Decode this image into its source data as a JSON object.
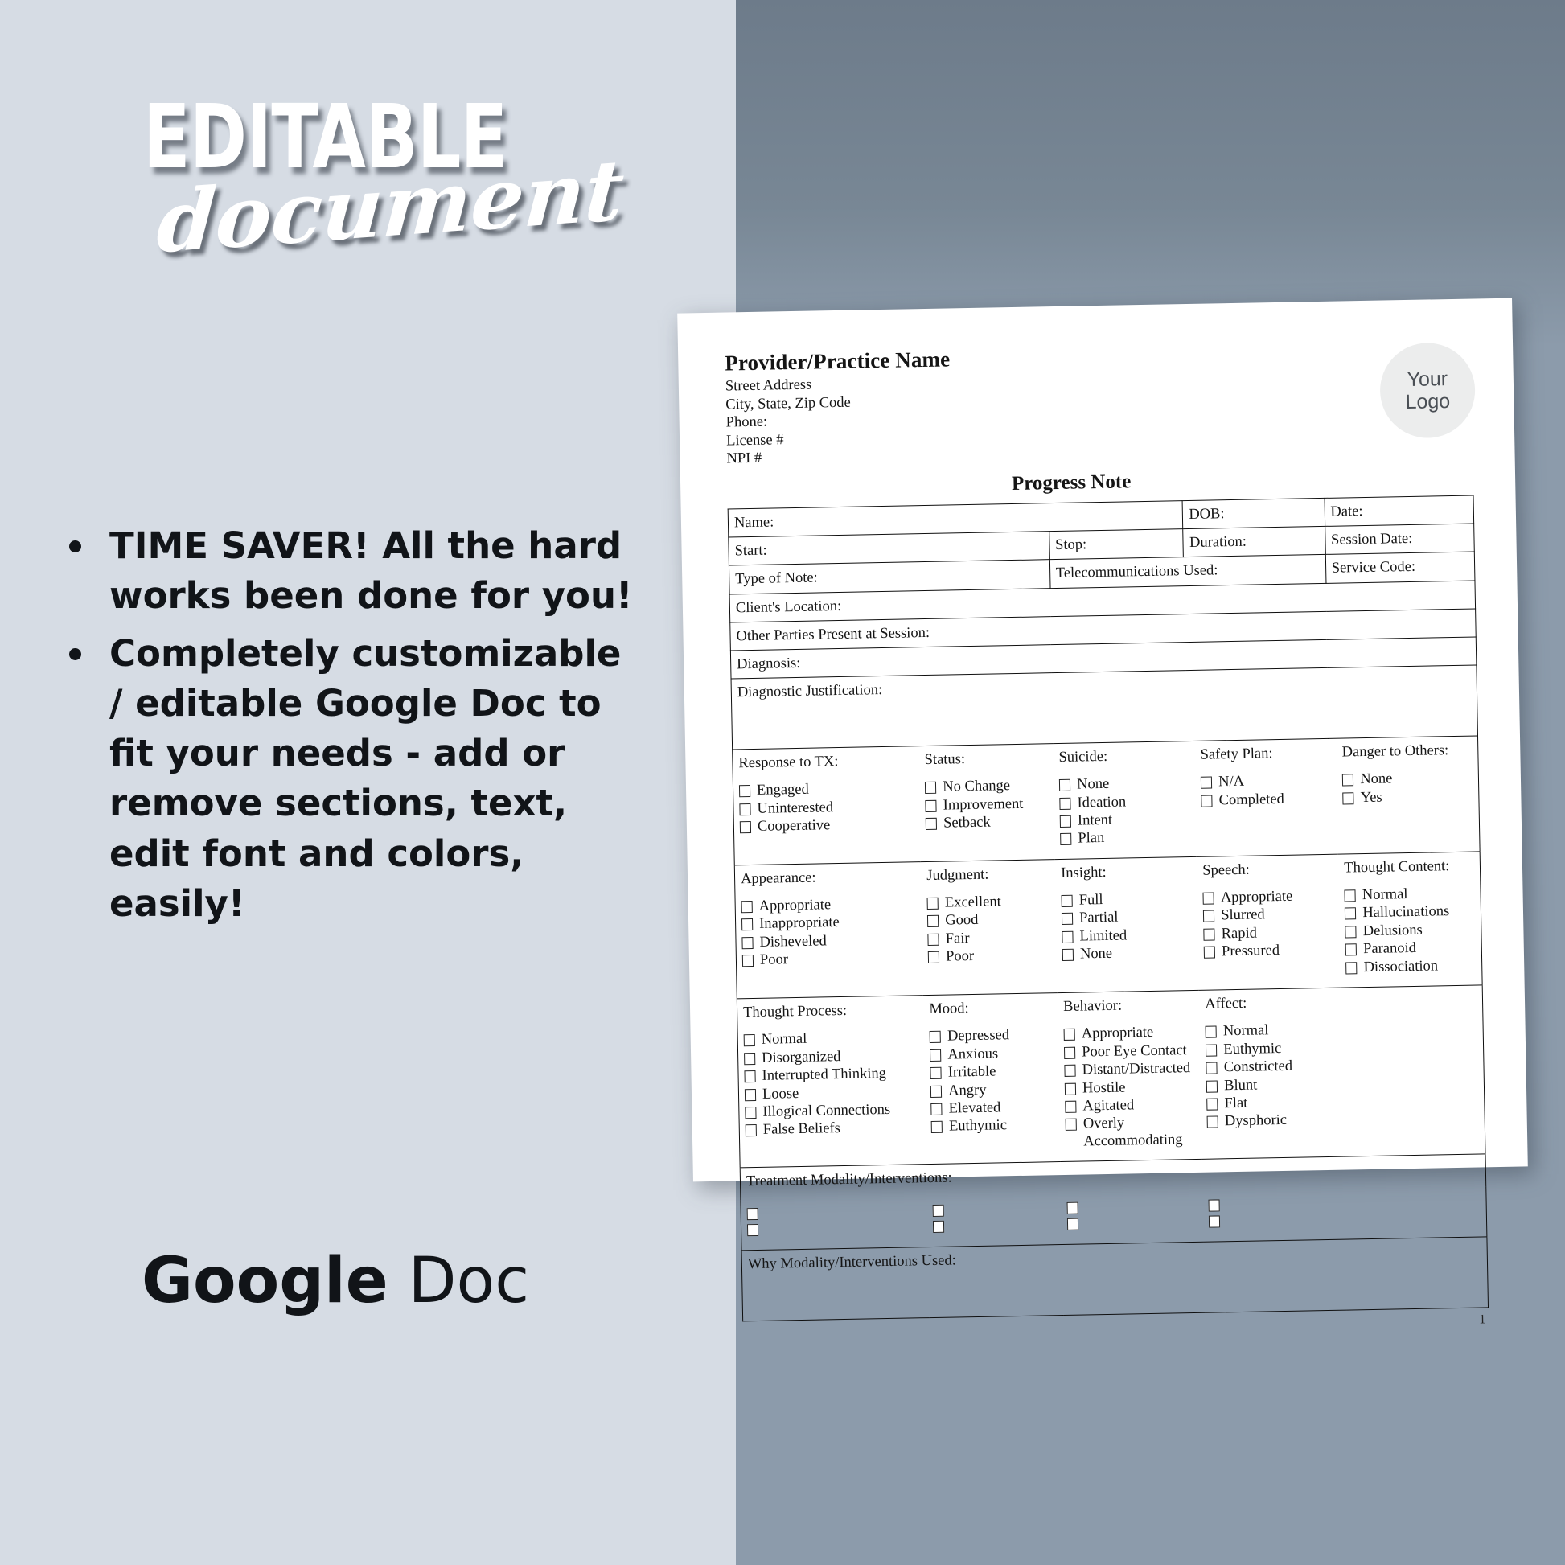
{
  "promo": {
    "headline_main": "EDITABLE",
    "headline_script": "document",
    "bullets": [
      "TIME SAVER!  All the hard works been done for you!",
      "Completely customizable / editable Google Doc to fit your needs - add or remove sections, text, edit font and colors, easily!"
    ],
    "footer_brand_strong": "Google",
    "footer_brand_light": " Doc"
  },
  "colors": {
    "left_panel": "#d6dce4",
    "right_panel": "#8c9bab",
    "right_panel_dark": "#6d7b8a",
    "text_dark": "#111418",
    "page_white": "#ffffff",
    "logo_fill": "#eceded"
  },
  "document": {
    "letterhead": {
      "practice_name": "Provider/Practice Name",
      "lines": [
        "Street Address",
        "City, State, Zip Code",
        "Phone:",
        "License #",
        "NPI #"
      ],
      "logo_line1": "Your",
      "logo_line2": "Logo"
    },
    "title": "Progress Note",
    "page_number": "1",
    "fields": {
      "name": "Name:",
      "dob": "DOB:",
      "date": "Date:",
      "start": "Start:",
      "stop": "Stop:",
      "duration": "Duration:",
      "session_date": "Session Date:",
      "type_of_note": "Type of Note:",
      "telecommunications": "Telecommunications Used:",
      "service_code": "Service Code:",
      "client_location": "Client's Location:",
      "other_parties": "Other Parties Present at Session:",
      "diagnosis": "Diagnosis:",
      "diagnostic_justification": "Diagnostic Justification:",
      "treatment_modality": "Treatment Modality/Interventions:",
      "why_modality": "Why Modality/Interventions Used:"
    },
    "checkbox_groups_row1": [
      {
        "head": "Response to TX:",
        "options": [
          "Engaged",
          "Uninterested",
          "Cooperative"
        ]
      },
      {
        "head": "Status:",
        "options": [
          "No Change",
          "Improvement",
          "Setback"
        ]
      },
      {
        "head": "Suicide:",
        "options": [
          "None",
          "Ideation",
          "Intent",
          "Plan"
        ]
      },
      {
        "head": "Safety Plan:",
        "options": [
          "N/A",
          "Completed"
        ]
      },
      {
        "head": "Danger to Others:",
        "options": [
          "None",
          "Yes"
        ]
      }
    ],
    "checkbox_groups_row2": [
      {
        "head": "Appearance:",
        "options": [
          "Appropriate",
          "Inappropriate",
          "Disheveled",
          "Poor"
        ]
      },
      {
        "head": "Judgment:",
        "options": [
          "Excellent",
          "Good",
          "Fair",
          "Poor"
        ]
      },
      {
        "head": "Insight:",
        "options": [
          "Full",
          "Partial",
          "Limited",
          "None"
        ]
      },
      {
        "head": "Speech:",
        "options": [
          "Appropriate",
          "Slurred",
          "Rapid",
          "Pressured"
        ]
      },
      {
        "head": "Thought Content:",
        "options": [
          "Normal",
          "Hallucinations",
          "Delusions",
          "Paranoid",
          "Dissociation"
        ]
      }
    ],
    "checkbox_groups_row3": [
      {
        "head": "Thought Process:",
        "options": [
          "Normal",
          "Disorganized",
          "Interrupted Thinking",
          "Loose",
          "Illogical Connections",
          "False Beliefs"
        ]
      },
      {
        "head": "Mood:",
        "options": [
          "Depressed",
          "Anxious",
          "Irritable",
          "Angry",
          "Elevated",
          "Euthymic"
        ]
      },
      {
        "head": "Behavior:",
        "options": [
          "Appropriate",
          "Poor Eye Contact",
          "Distant/Distracted",
          "Hostile",
          "Agitated",
          "Overly Accommodating"
        ]
      },
      {
        "head": "Affect:",
        "options": [
          "Normal",
          "Euthymic",
          "Constricted",
          "Blunt",
          "Flat",
          "Dysphoric"
        ]
      }
    ],
    "modality_columns": 4,
    "modality_boxes_per_column": 2
  }
}
